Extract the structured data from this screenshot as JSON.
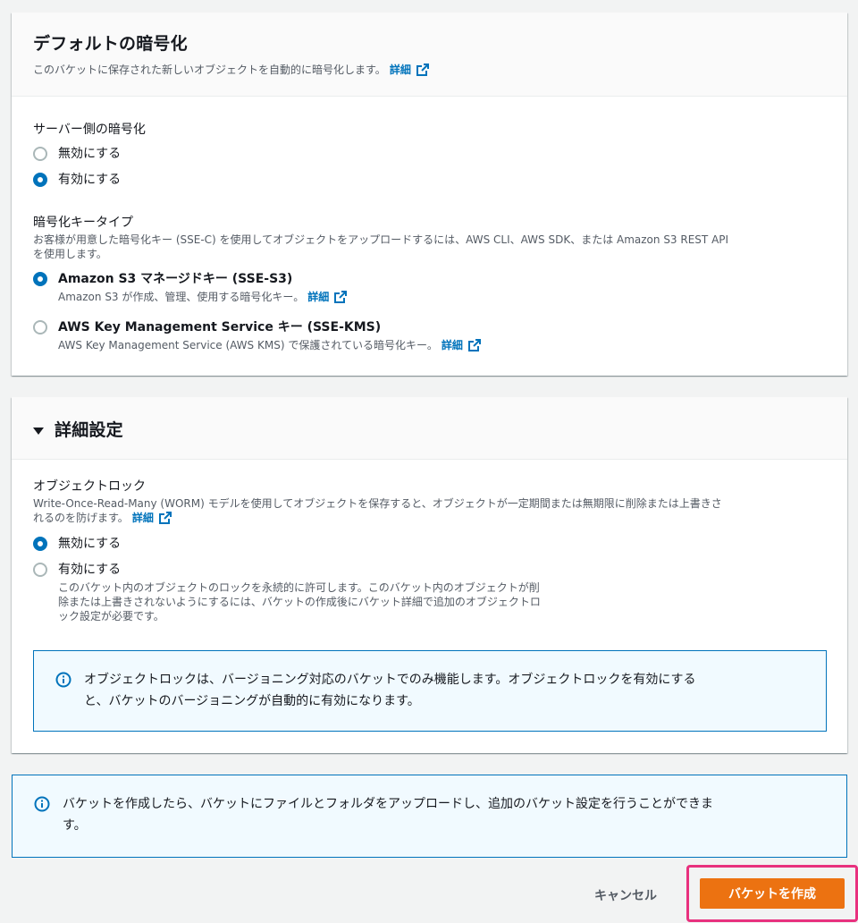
{
  "encryption": {
    "title": "デフォルトの暗号化",
    "description": "このバケットに保存された新しいオブジェクトを自動的に暗号化します。",
    "details_link": "詳細",
    "server_side_label": "サーバー側の暗号化",
    "server_side_options": [
      {
        "label": "無効にする",
        "checked": false
      },
      {
        "label": "有効にする",
        "checked": true
      }
    ],
    "key_type_label": "暗号化キータイプ",
    "key_type_desc_line1": "お客様が用意した暗号化キー (SSE-C) を使用してオブジェクトをアップロードするには、AWS CLI、AWS SDK、または Amazon S3 REST API",
    "key_type_desc_line2": "を使用します。",
    "key_options": [
      {
        "label": "Amazon S3 マネージドキー (SSE-S3)",
        "desc": "Amazon S3 が作成、管理、使用する暗号化キー。",
        "link": "詳細",
        "checked": true
      },
      {
        "label": "AWS Key Management Service キー (SSE-KMS)",
        "desc": "AWS Key Management Service (AWS KMS) で保護されている暗号化キー。",
        "link": "詳細",
        "checked": false
      }
    ]
  },
  "advanced": {
    "title": "詳細設定",
    "object_lock_label": "オブジェクトロック",
    "object_lock_desc_line1": "Write-Once-Read-Many (WORM) モデルを使用してオブジェクトを保存すると、オブジェクトが一定期間または無期限に削除または上書きさ",
    "object_lock_desc_line2": "れるのを防げます。",
    "details_link": "詳細",
    "options": [
      {
        "label": "無効にする",
        "checked": true
      },
      {
        "label": "有効にする",
        "checked": false
      }
    ],
    "enable_desc_line1": "このバケット内のオブジェクトのロックを永続的に許可します。このバケット内のオブジェクトが削",
    "enable_desc_line2": "除または上書きされないようにするには、バケットの作成後にバケット詳細で追加のオブジェクトロ",
    "enable_desc_line3": "ック設定が必要です。",
    "info_line1": "オブジェクトロックは、バージョニング対応のバケットでのみ機能します。オブジェクトロックを有効にする",
    "info_line2": "と、バケットのバージョニングが自動的に有効になります。"
  },
  "bottom_info": {
    "line1": "バケットを作成したら、バケットにファイルとフォルダをアップロードし、追加のバケット設定を行うことができま",
    "line2": "す。"
  },
  "footer": {
    "cancel_label": "キャンセル",
    "create_label": "バケットを作成"
  },
  "colors": {
    "link": "#0073bb",
    "primary_button": "#ec7211",
    "highlight_border": "#e8317e",
    "info_border": "#0073bb",
    "info_bg": "#f1faff"
  }
}
